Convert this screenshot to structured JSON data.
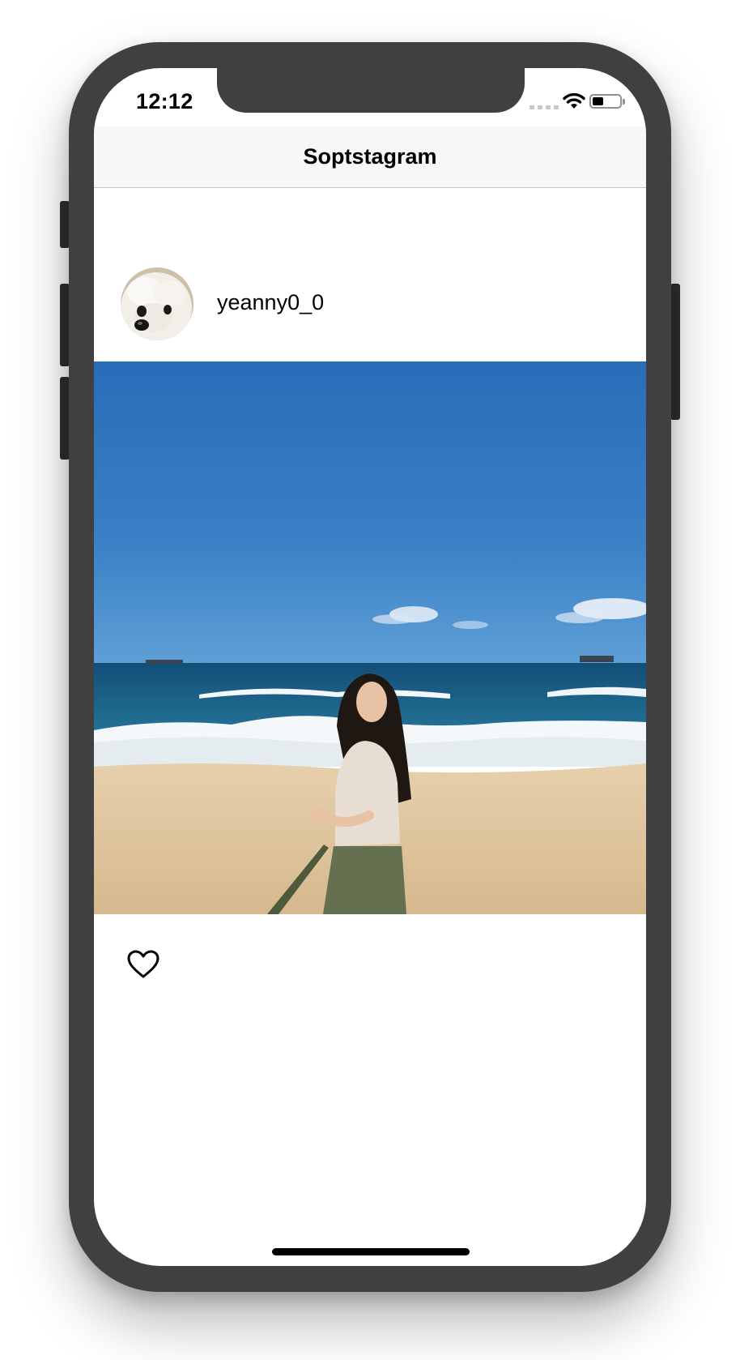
{
  "status_bar": {
    "time": "12:12",
    "battery_level": 0.4
  },
  "nav": {
    "title": "Soptstagram"
  },
  "post": {
    "username": "yeanny0_0",
    "avatar_icon": "white-dog-avatar",
    "photo_subject": "beach-photo",
    "liked": false
  },
  "icons": {
    "like": "heart-outline-icon",
    "wifi": "wifi-icon",
    "battery": "battery-icon",
    "signal": "cellular-signal-icon"
  },
  "colors": {
    "frame": "#404040",
    "sky_top": "#2b6cb8",
    "sky_bottom": "#5a9bd4",
    "sea": "#1f6a8f",
    "sand": "#e3cba4"
  }
}
